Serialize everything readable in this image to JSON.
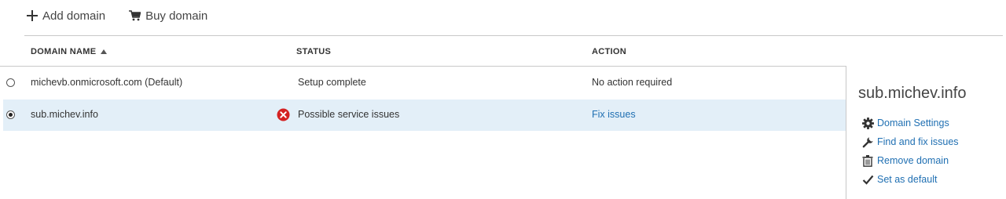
{
  "toolbar": {
    "add_domain": "Add domain",
    "buy_domain": "Buy domain"
  },
  "table": {
    "columns": {
      "domain_name": "DOMAIN NAME",
      "status": "STATUS",
      "action": "ACTION"
    },
    "sort": {
      "column": "domain_name",
      "direction": "ascending"
    },
    "rows": [
      {
        "domain": "michevb.onmicrosoft.com (Default)",
        "status": "Setup complete",
        "action": "No action required",
        "selected": false
      },
      {
        "domain": "sub.michev.info",
        "status": "Possible service issues",
        "status_icon": "error-icon",
        "action": "Fix issues",
        "selected": true
      }
    ]
  },
  "details": {
    "title": "sub.michev.info",
    "actions": [
      {
        "label": "Domain Settings",
        "icon": "gear-icon"
      },
      {
        "label": "Find and fix issues",
        "icon": "wrench-icon"
      },
      {
        "label": "Remove domain",
        "icon": "trash-icon"
      },
      {
        "label": "Set as default",
        "icon": "checkmark-icon"
      }
    ]
  },
  "colors": {
    "link": "#1f6fb2",
    "selected_row": "#e3eff8",
    "error": "#d42222"
  }
}
